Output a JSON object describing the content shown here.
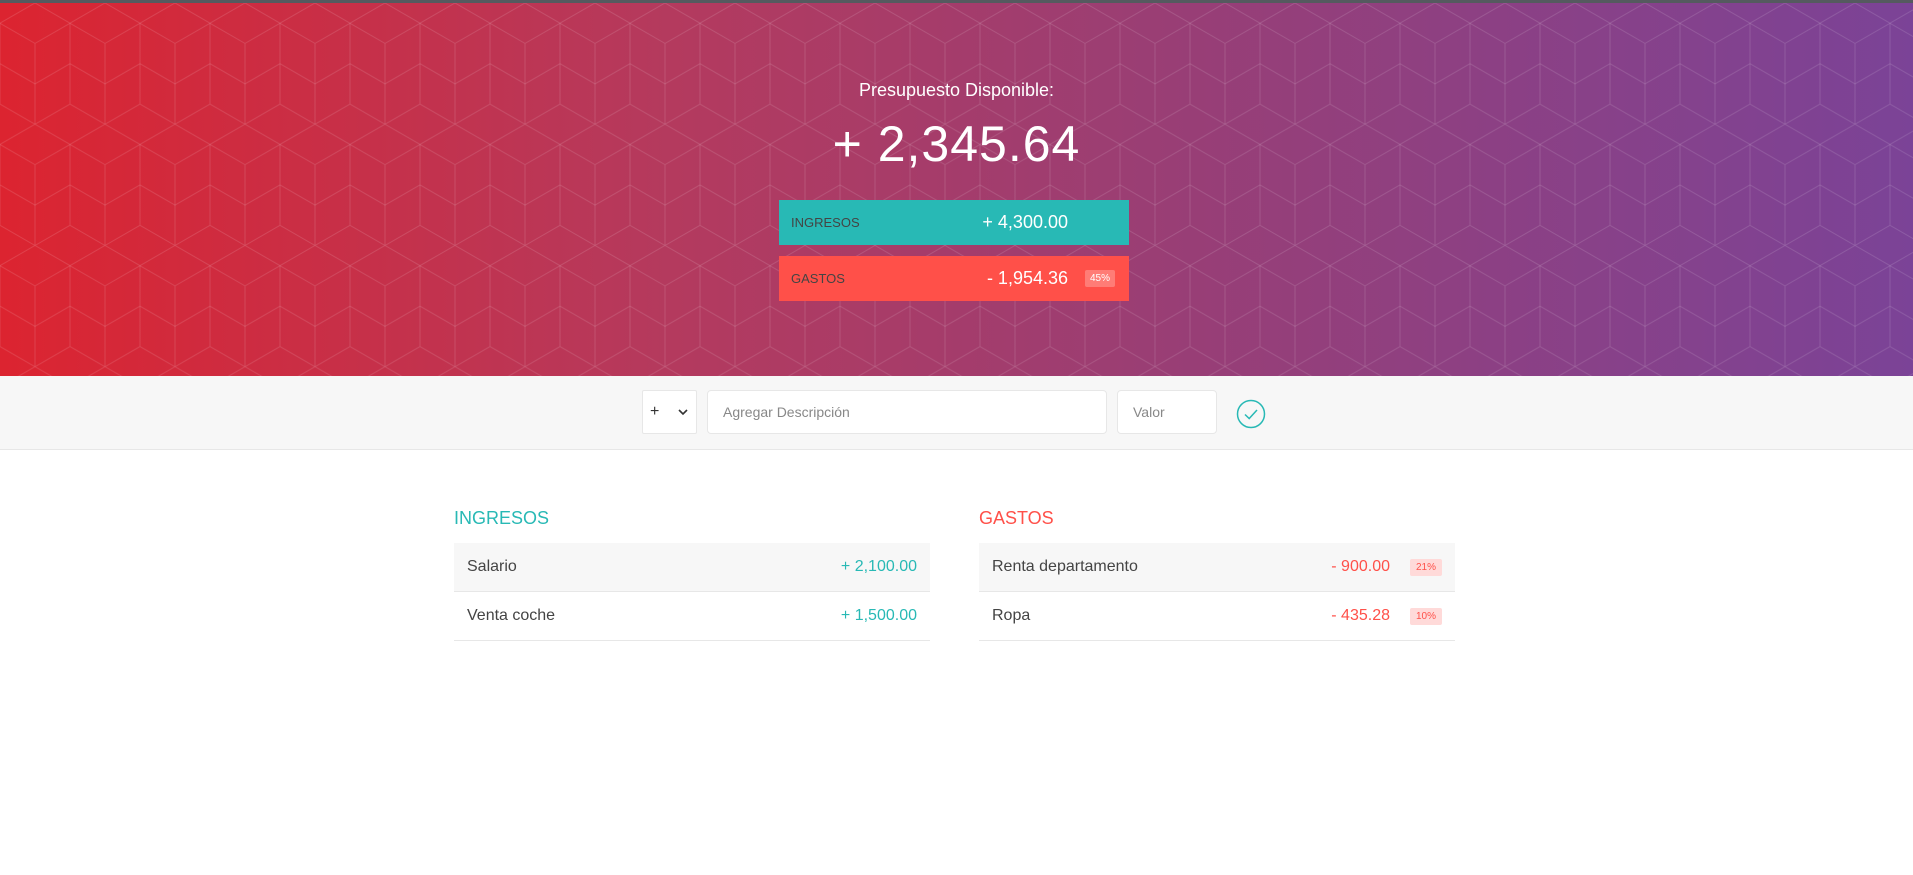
{
  "header": {
    "title": "Presupuesto Disponible:",
    "budget": "+ 2,345.64",
    "income_label": "Ingresos",
    "income_value": "+ 4,300.00",
    "expense_label": "Gastos",
    "expense_value": "- 1,954.36",
    "expense_percentage": "45%"
  },
  "add_form": {
    "type_selected": "+",
    "description_placeholder": "Agregar Descripción",
    "value_placeholder": "Valor",
    "submit_icon": "checkmark-circle-icon"
  },
  "income": {
    "title": "Ingresos",
    "items": [
      {
        "description": "Salario",
        "value": "+ 2,100.00"
      },
      {
        "description": "Venta coche",
        "value": "+ 1,500.00"
      }
    ]
  },
  "expenses": {
    "title": "Gastos",
    "items": [
      {
        "description": "Renta departamento",
        "value": "- 900.00",
        "percentage": "21%"
      },
      {
        "description": "Ropa",
        "value": "- 435.28",
        "percentage": "10%"
      }
    ]
  },
  "colors": {
    "income": "#28b9b5",
    "expense": "#ff5049",
    "gradient_start": "#dc2430",
    "gradient_end": "#7b4397"
  }
}
